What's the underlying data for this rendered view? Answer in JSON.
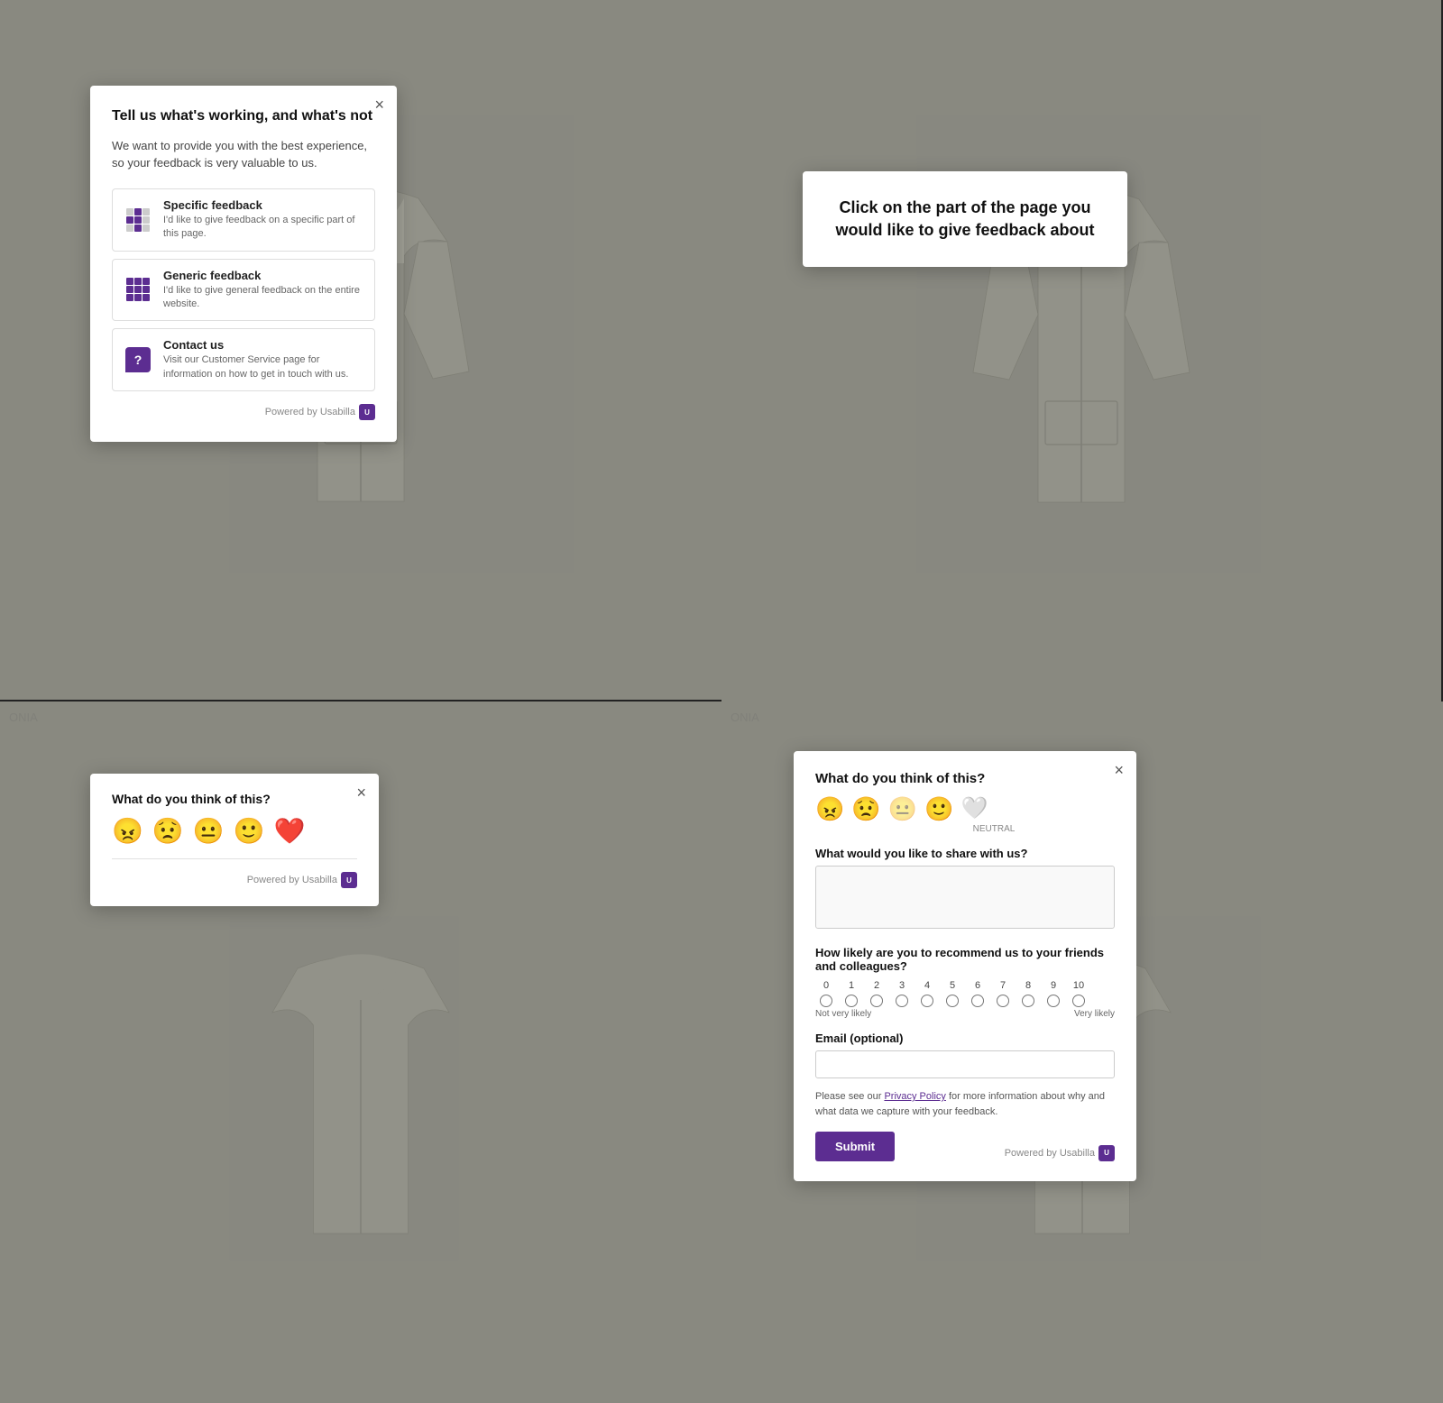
{
  "quadrant1": {
    "modal": {
      "title": "Tell us what's working, and what's not",
      "intro": "We want to provide you with the best experience, so your feedback is very valuable to us.",
      "options": [
        {
          "id": "specific",
          "title": "Specific feedback",
          "description": "I'd like to give feedback on a specific part of this page.",
          "icon_type": "specific"
        },
        {
          "id": "generic",
          "title": "Generic feedback",
          "description": "I'd like to give general feedback on the entire website.",
          "icon_type": "generic"
        },
        {
          "id": "contact",
          "title": "Contact us",
          "description": "Visit our Customer Service page for information on how to get in touch with us.",
          "icon_type": "contact"
        }
      ],
      "powered_by": "Powered by Usabilla"
    }
  },
  "quadrant2": {
    "modal": {
      "instruction": "Click on the part of the page you would like to give feedback about"
    }
  },
  "quadrant3": {
    "brand_label": "ONIA",
    "modal": {
      "question": "What do you think of this?",
      "emojis": [
        "😠",
        "😟",
        "😐",
        "🙂",
        "❤️"
      ],
      "powered_by": "Powered by Usabilla"
    }
  },
  "quadrant4": {
    "brand_label": "ONIA",
    "modal": {
      "question": "What do you think of this?",
      "emojis": [
        "😠",
        "😟",
        "😐",
        "🙂",
        "🤍"
      ],
      "neutral_label": "NEUTRAL",
      "share_label": "What would you like to share with us?",
      "share_placeholder": "",
      "recommend_label": "How likely are you to recommend us to your friends and colleagues?",
      "nps_numbers": [
        "0",
        "1",
        "2",
        "3",
        "4",
        "5",
        "6",
        "7",
        "8",
        "9",
        "10"
      ],
      "nps_left_label": "Not very likely",
      "nps_right_label": "Very likely",
      "email_label": "Email (optional)",
      "privacy_text_before": "Please see our ",
      "privacy_link_text": "Privacy Policy",
      "privacy_text_after": " for more information about why and what data we capture with your feedback.",
      "submit_label": "Submit",
      "powered_by": "Powered by Usabilla"
    }
  }
}
